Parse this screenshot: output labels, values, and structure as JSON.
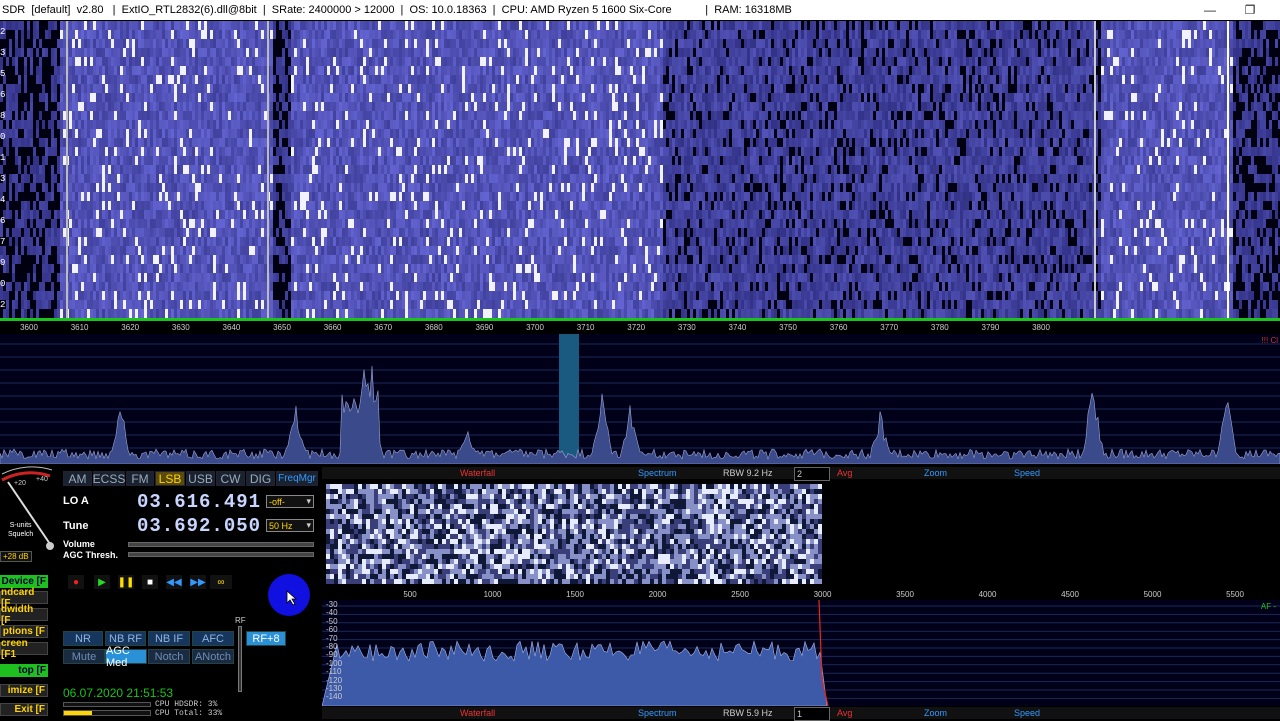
{
  "window": {
    "title": "SDR  [default]  v2.80   |  ExtIO_RTL2832(6).dll@8bit  |  SRate: 2400000 > 12000  |  OS: 10.0.18363  |  CPU: AMD Ryzen 5 1600 Six-Core           |  RAM: 16318MB",
    "minimize": "—",
    "restore": "❐"
  },
  "waterfall": {
    "y_labels": [
      "2",
      "3",
      "5",
      "6",
      "8",
      "0",
      "1",
      "3",
      "4",
      "6",
      "7",
      "9",
      "0",
      "2"
    ]
  },
  "freq_axis": {
    "labels": [
      "3600",
      "3610",
      "3620",
      "3630",
      "3640",
      "3650",
      "3660",
      "3670",
      "3680",
      "3690",
      "3700",
      "3710",
      "3720",
      "3730",
      "3740",
      "3750",
      "3760",
      "3770",
      "3780",
      "3790",
      "3800"
    ],
    "overload": "!!! Cl"
  },
  "smeter": {
    "label": "S-units\nSquelch",
    "db": "+28 dB",
    "scale": [
      "+20",
      "+40"
    ]
  },
  "modes": [
    "AM",
    "ECSS",
    "FM",
    "LSB",
    "USB",
    "CW",
    "DIG",
    "FreqMgr"
  ],
  "active_mode": "LSB",
  "lo": {
    "label": "LO A",
    "value": "03.616.491",
    "sel": "-off-"
  },
  "tune": {
    "label": "Tune",
    "value": "03.692.050",
    "sel": "50 Hz"
  },
  "volume_label": "Volume",
  "agc_label": "AGC Thresh.",
  "side_buttons": [
    "Device [F",
    "ndcard [F",
    "dwidth [F",
    "ptions [F",
    "creen [F1",
    "top [F",
    "imize [F",
    "Exit [F"
  ],
  "dsp_row1": [
    "NR",
    "NB RF",
    "NB IF",
    "AFC",
    "RF+8"
  ],
  "dsp_row2": [
    "Mute",
    "AGC Med",
    "Notch",
    "ANotch"
  ],
  "rf_label": "RF",
  "datetime": "06.07.2020 21:51:53",
  "cpu": {
    "hdsdr": "CPU HDSDR: 3%",
    "total": "CPU Total: 33%"
  },
  "toolbar_top": {
    "waterfall": "Waterfall",
    "spectrum": "Spectrum",
    "rbw": "RBW  9.2 Hz",
    "avg_val": "2",
    "avg": "Avg",
    "zoom": "Zoom",
    "speed": "Speed"
  },
  "toolbar_bottom": {
    "waterfall": "Waterfall",
    "spectrum": "Spectrum",
    "rbw": "RBW  5.9 Hz",
    "avg_val": "1",
    "avg": "Avg",
    "zoom": "Zoom",
    "speed": "Speed"
  },
  "af_axis": [
    "500",
    "1000",
    "1500",
    "2000",
    "2500",
    "3000",
    "3500",
    "4000",
    "4500",
    "5000",
    "5500"
  ],
  "af_ylabels": [
    "-30",
    "-40",
    "-50",
    "-60",
    "-70",
    "-80",
    "-90",
    "-100",
    "-110",
    "-120",
    "-130",
    "-140"
  ],
  "af_label": "AF -",
  "colors": {
    "accent_green": "#1bc41b",
    "lsb_yellow": "#ffd400",
    "waterfall_blue": "#2a2a9a"
  }
}
